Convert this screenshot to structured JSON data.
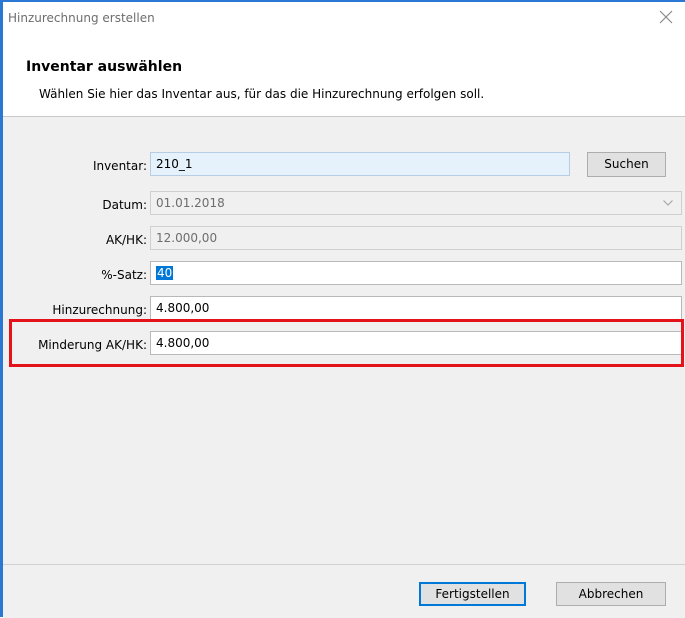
{
  "window": {
    "title": "Hinzurechnung erstellen"
  },
  "header": {
    "title": "Inventar auswählen",
    "description": "Wählen Sie hier das Inventar aus, für das die Hinzurechnung erfolgen soll."
  },
  "form": {
    "inventar": {
      "label": "Inventar:",
      "value": "210_1"
    },
    "search_button": "Suchen",
    "datum": {
      "label": "Datum:",
      "value": "01.01.2018"
    },
    "akhk": {
      "label": "AK/HK:",
      "value": "12.000,00"
    },
    "satz": {
      "label": "%-Satz:",
      "value": "40"
    },
    "hinzurechnung": {
      "label": "Hinzurechnung:",
      "value": "4.800,00"
    },
    "minderung": {
      "label": "Minderung AK/HK:",
      "value": "4.800,00"
    }
  },
  "footer": {
    "finish_button": "Fertigstellen",
    "cancel_button": "Abbrechen"
  },
  "colors": {
    "accent": "#0078d7",
    "highlight": "#e4131a"
  },
  "icons": {
    "close": "close-icon",
    "dropdown": "chevron-down-icon"
  }
}
